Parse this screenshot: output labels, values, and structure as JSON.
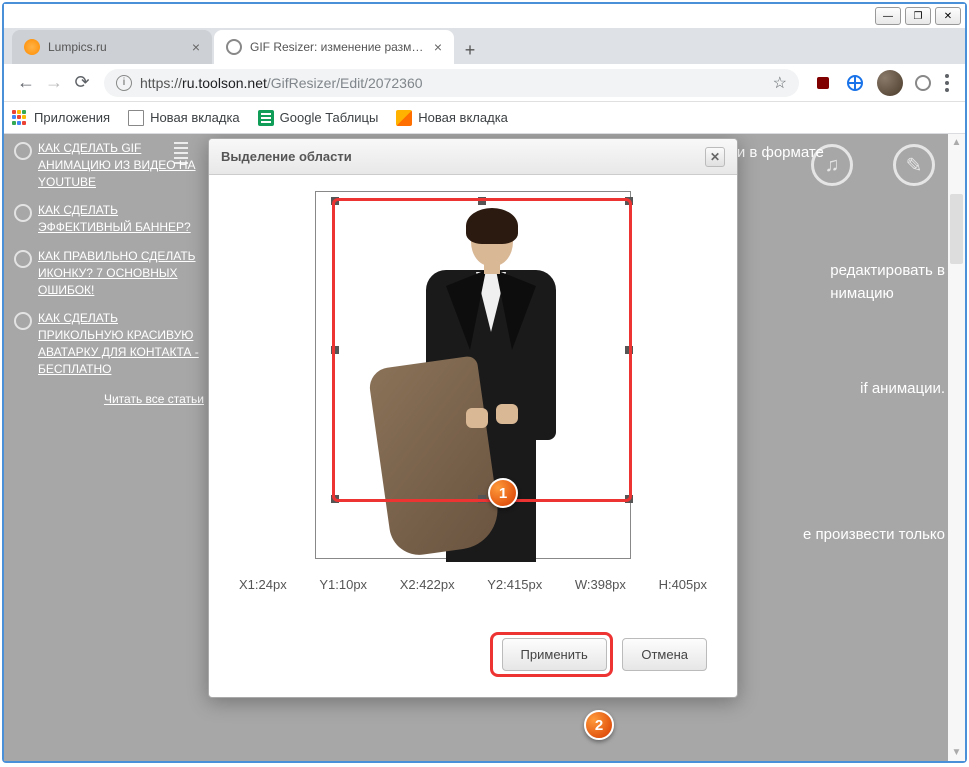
{
  "window": {
    "minimize": "—",
    "maximize": "❐",
    "close": "✕"
  },
  "tabs": [
    {
      "title": "Lumpics.ru",
      "active": false
    },
    {
      "title": "GIF Resizer: изменение размера",
      "active": true
    }
  ],
  "address": {
    "scheme": "https://",
    "host": "ru.toolson.net",
    "path": "/GifResizer/Edit/2072360"
  },
  "bookmarks": {
    "apps": "Приложения",
    "items": [
      "Новая вкладка",
      "Google Таблицы",
      "Новая вкладка"
    ]
  },
  "sidebar": {
    "items": [
      "КАК СДЕЛАТЬ GIF АНИМАЦИЮ ИЗ ВИДЕО НА YOUTUBE",
      "КАК СДЕЛАТЬ ЭФФЕКТИВНЫЙ БАННЕР?",
      "КАК ПРАВИЛЬНО СДЕЛАТЬ ИКОНКУ? 7 ОСНОВНЫХ ОШИБОК!",
      "КАК СДЕЛАТЬ ПРИКОЛЬНУЮ КРАСИВУЮ АВАТАРКУ ДЛЯ КОНТАКТА - БЕСПЛАТНО"
    ],
    "read_all": "Читать все статьи"
  },
  "bg_texts": {
    "t1": "На ваш компьютер скачается архив со всеми кадрами вашей анимации в формате",
    "t2a": "редактировать в",
    "t2b": "нимацию",
    "t3": "if анимации.",
    "t4": "е произвести только"
  },
  "dialog": {
    "title": "Выделение области",
    "coords": {
      "x1": "X1:24px",
      "y1": "Y1:10px",
      "x2": "X2:422px",
      "y2": "Y2:415px",
      "w": "W:398px",
      "h": "H:405px"
    },
    "apply": "Применить",
    "cancel": "Отмена"
  },
  "badges": {
    "one": "1",
    "two": "2"
  }
}
